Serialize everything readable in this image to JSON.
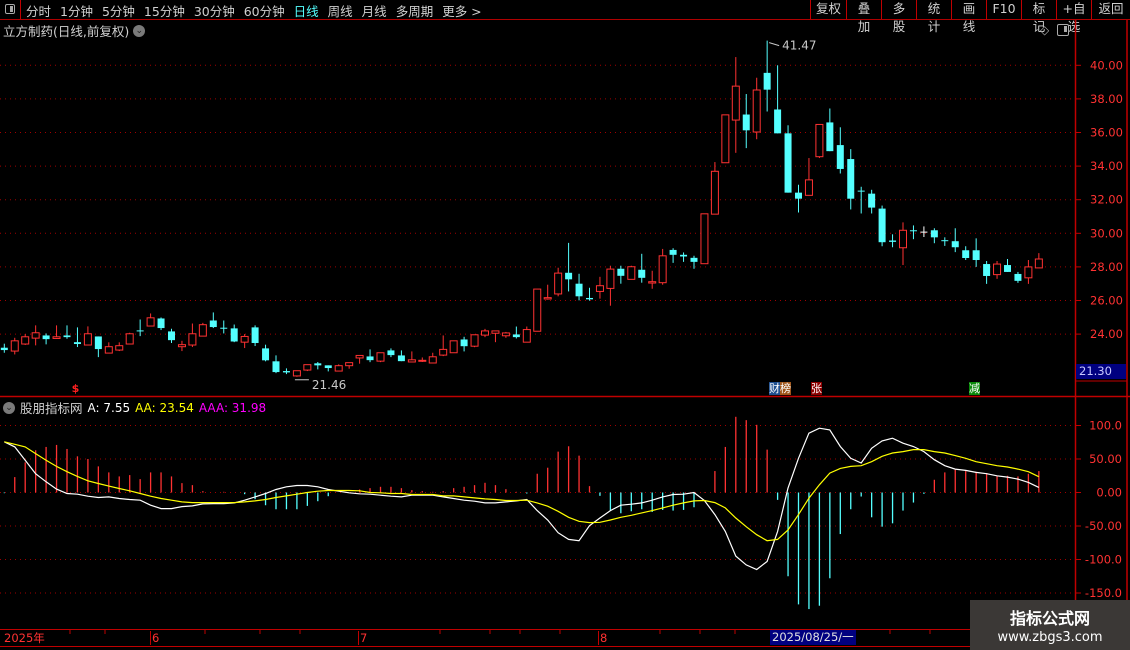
{
  "toolbar": {
    "periods": [
      "分时",
      "1分钟",
      "5分钟",
      "15分钟",
      "30分钟",
      "60分钟",
      "日线",
      "周线",
      "月线",
      "多周期",
      "更多 >"
    ],
    "active_period": "日线",
    "buttons": [
      "复权",
      "叠加",
      "多股",
      "统计",
      "画线",
      "F10",
      "标记",
      "+自选",
      "返回"
    ]
  },
  "main_chart": {
    "title": "立方制药(日线,前复权)",
    "max_label": "41.47",
    "min_label": "21.46",
    "cursor_price": "21.30",
    "price_ticks": [
      "40.00",
      "38.00",
      "36.00",
      "34.00",
      "32.00",
      "30.00",
      "28.00",
      "26.00",
      "24.00"
    ],
    "markers": [
      {
        "text": "$",
        "bg": "",
        "color": "#ff2020"
      },
      {
        "text": "财",
        "bg": "#1f4f8f",
        "color": "#ffffff"
      },
      {
        "text": "榜",
        "bg": "#a0561a",
        "color": "#ffffff"
      },
      {
        "text": "张",
        "bg": "#8b0000",
        "color": "#ffffff"
      },
      {
        "text": "减",
        "bg": "#0a8a0a",
        "color": "#ffffff"
      }
    ]
  },
  "indicator": {
    "name": "股朋指标网",
    "a_label": "A: 7.55",
    "aa_label": "AA: 23.54",
    "aaa_label": "AAA: 31.98",
    "ticks": [
      "100.0",
      "50.00",
      "0.00",
      "-50.00",
      "-100.0",
      "-150.0"
    ]
  },
  "time_axis": {
    "labels": [
      "2025年",
      "6",
      "7",
      "8"
    ],
    "cursor_date": "2025/08/25/一"
  },
  "watermark": {
    "line1": "指标公式网",
    "line2": "www.zbgs3.com"
  },
  "colors": {
    "up": "#ff3232",
    "down": "#54ffff",
    "grid": "#b00000",
    "A": "#ffffff",
    "AA": "#ffff00",
    "AAA": "#ff00ff",
    "accent": "#54ffff"
  },
  "chart_data": [
    {
      "type": "candlestick",
      "ylim": [
        21,
        41.5
      ],
      "ohlc": [
        [
          23.19,
          23.43,
          22.89,
          23.05
        ],
        [
          22.99,
          23.78,
          22.79,
          23.6
        ],
        [
          23.41,
          24.0,
          23.35,
          23.84
        ],
        [
          23.76,
          24.52,
          23.33,
          24.08
        ],
        [
          23.92,
          24.04,
          23.39,
          23.7
        ],
        [
          23.74,
          24.52,
          23.72,
          23.84
        ],
        [
          23.92,
          24.52,
          23.72,
          23.82
        ],
        [
          23.52,
          24.4,
          23.23,
          23.41
        ],
        [
          23.35,
          24.46,
          23.35,
          24.02
        ],
        [
          23.86,
          23.86,
          22.63,
          23.11
        ],
        [
          22.87,
          23.51,
          22.87,
          23.25
        ],
        [
          23.05,
          23.51,
          22.99,
          23.31
        ],
        [
          23.41,
          24.08,
          23.41,
          24.02
        ],
        [
          24.22,
          24.87,
          23.88,
          24.16
        ],
        [
          24.48,
          25.23,
          24.48,
          24.97
        ],
        [
          24.93,
          24.99,
          24.24,
          24.36
        ],
        [
          24.16,
          24.32,
          23.47,
          23.64
        ],
        [
          23.25,
          23.6,
          22.99,
          23.37
        ],
        [
          23.35,
          24.63,
          23.23,
          24.02
        ],
        [
          23.88,
          24.67,
          23.88,
          24.56
        ],
        [
          24.81,
          25.29,
          24.36,
          24.42
        ],
        [
          24.38,
          24.81,
          24.04,
          24.32
        ],
        [
          24.34,
          24.57,
          23.52,
          23.56
        ],
        [
          23.52,
          24.0,
          23.17,
          23.86
        ],
        [
          24.4,
          24.52,
          23.29,
          23.47
        ],
        [
          23.15,
          23.37,
          22.38,
          22.44
        ],
        [
          22.38,
          22.73,
          21.68,
          21.74
        ],
        [
          21.8,
          21.96,
          21.62,
          21.72
        ],
        [
          21.51,
          21.82,
          21.46,
          21.82
        ],
        [
          21.86,
          22.18,
          21.8,
          22.18
        ],
        [
          22.26,
          22.34,
          21.9,
          22.14
        ],
        [
          22.14,
          22.14,
          21.78,
          21.98
        ],
        [
          21.8,
          22.2,
          21.8,
          22.12
        ],
        [
          22.12,
          22.3,
          21.94,
          22.3
        ],
        [
          22.58,
          22.73,
          22.24,
          22.73
        ],
        [
          22.67,
          23.09,
          22.33,
          22.45
        ],
        [
          22.39,
          22.89,
          22.33,
          22.89
        ],
        [
          23.03,
          23.15,
          22.63,
          22.75
        ],
        [
          22.73,
          23.03,
          22.39,
          22.39
        ],
        [
          22.34,
          22.97,
          22.34,
          22.47
        ],
        [
          22.4,
          22.61,
          22.34,
          22.44
        ],
        [
          22.28,
          22.89,
          22.28,
          22.65
        ],
        [
          22.75,
          23.92,
          22.69,
          23.09
        ],
        [
          22.89,
          23.6,
          22.89,
          23.6
        ],
        [
          23.68,
          23.84,
          22.97,
          23.28
        ],
        [
          23.28,
          23.96,
          23.22,
          23.96
        ],
        [
          23.94,
          24.31,
          23.82,
          24.19
        ],
        [
          24.05,
          24.19,
          23.52,
          24.19
        ],
        [
          23.9,
          24.13,
          23.78,
          24.07
        ],
        [
          23.98,
          24.45,
          23.74,
          23.82
        ],
        [
          23.52,
          24.45,
          23.52,
          24.27
        ],
        [
          24.17,
          26.68,
          24.17,
          26.68
        ],
        [
          26.09,
          26.94,
          26.05,
          26.17
        ],
        [
          26.39,
          27.95,
          26.25,
          27.63
        ],
        [
          27.65,
          29.43,
          26.54,
          27.26
        ],
        [
          27.0,
          27.59,
          26.01,
          26.25
        ],
        [
          26.15,
          26.76,
          25.99,
          26.07
        ],
        [
          26.54,
          27.41,
          26.11,
          26.88
        ],
        [
          26.72,
          28.07,
          25.69,
          27.87
        ],
        [
          27.89,
          28.07,
          27.0,
          27.47
        ],
        [
          27.26,
          28.07,
          27.26,
          28.01
        ],
        [
          27.83,
          28.78,
          27.06,
          27.35
        ],
        [
          27.04,
          27.77,
          26.7,
          27.12
        ],
        [
          27.06,
          29.07,
          26.94,
          28.66
        ],
        [
          29.01,
          29.11,
          28.24,
          28.72
        ],
        [
          28.72,
          28.86,
          28.3,
          28.62
        ],
        [
          28.54,
          28.66,
          27.89,
          28.3
        ],
        [
          28.19,
          31.16,
          28.19,
          31.16
        ],
        [
          31.14,
          34.24,
          31.14,
          33.69
        ],
        [
          34.2,
          37.05,
          34.2,
          37.05
        ],
        [
          36.74,
          40.49,
          34.79,
          38.76
        ],
        [
          37.07,
          38.29,
          35.07,
          36.13
        ],
        [
          36.03,
          39.26,
          35.6,
          38.53
        ],
        [
          39.55,
          41.47,
          37.25,
          38.55
        ],
        [
          37.37,
          40.0,
          35.95,
          35.95
        ],
        [
          35.95,
          36.43,
          32.42,
          32.42
        ],
        [
          32.42,
          32.89,
          31.24,
          32.06
        ],
        [
          32.26,
          34.48,
          32.26,
          33.18
        ],
        [
          34.56,
          36.48,
          34.48,
          36.48
        ],
        [
          36.6,
          37.43,
          34.89,
          34.89
        ],
        [
          35.25,
          36.31,
          33.56,
          33.83
        ],
        [
          34.42,
          35.01,
          31.42,
          32.06
        ],
        [
          32.54,
          32.77,
          31.18,
          32.5
        ],
        [
          32.36,
          32.59,
          31.18,
          31.53
        ],
        [
          31.47,
          31.65,
          29.23,
          29.47
        ],
        [
          29.57,
          29.94,
          29.17,
          29.49
        ],
        [
          29.14,
          30.65,
          28.11,
          30.18
        ],
        [
          30.18,
          30.47,
          29.65,
          30.14
        ],
        [
          30.1,
          30.41,
          29.78,
          30.1
        ],
        [
          30.18,
          30.3,
          29.41,
          29.76
        ],
        [
          29.59,
          29.76,
          29.25,
          29.55
        ],
        [
          29.53,
          30.3,
          28.88,
          29.17
        ],
        [
          28.99,
          29.23,
          28.41,
          28.53
        ],
        [
          28.99,
          29.7,
          28.0,
          28.41
        ],
        [
          28.17,
          28.35,
          26.99,
          27.46
        ],
        [
          27.54,
          28.35,
          27.29,
          28.17
        ],
        [
          28.11,
          28.47,
          27.7,
          27.7
        ],
        [
          27.58,
          27.7,
          27.05,
          27.17
        ],
        [
          27.35,
          28.41,
          26.99,
          28.0
        ],
        [
          27.94,
          28.82,
          27.94,
          28.47
        ]
      ]
    },
    {
      "type": "line",
      "ylim": [
        -175,
        125
      ],
      "series": [
        {
          "name": "A",
          "values": [
            75.6,
            68,
            48,
            28,
            16,
            5,
            -1.5,
            -2.5,
            -5.5,
            -7.5,
            -6.5,
            -9,
            -10.5,
            -11.5,
            -19,
            -24,
            -24,
            -21,
            -20,
            -17,
            -16.5,
            -16.5,
            -15.5,
            -11.5,
            -6.5,
            -1.5,
            4.5,
            8.5,
            10.5,
            10.5,
            8.5,
            4.5,
            2,
            -0.5,
            -2,
            -2.5,
            -4,
            -5.5,
            -6.5,
            -4,
            -4,
            -4,
            -6.5,
            -9,
            -11.5,
            -13,
            -15.5,
            -15.5,
            -14,
            -12.5,
            -10.5,
            -27,
            -41,
            -60,
            -70,
            -72,
            -49.5,
            -38,
            -27,
            -19,
            -17.5,
            -15.5,
            -11.5,
            -6.5,
            -3,
            -2.5,
            0,
            -12,
            -33,
            -58,
            -95,
            -108,
            -115,
            -103,
            -58,
            6.5,
            51,
            88.5,
            96,
            93.5,
            68.7,
            51,
            44,
            66,
            77,
            81,
            73.6,
            68.7,
            61,
            49,
            40,
            35,
            33,
            30,
            28,
            25,
            23,
            20,
            15,
            7.55
          ]
        },
        {
          "name": "AA",
          "values": [
            75.6,
            72,
            68,
            58,
            48,
            39,
            31,
            24,
            17.5,
            13.5,
            9.5,
            6,
            2.5,
            -1.5,
            -5.5,
            -9,
            -11.5,
            -14,
            -15,
            -15,
            -15,
            -15,
            -15,
            -14,
            -12.5,
            -10.5,
            -7.5,
            -5,
            -2.5,
            0,
            2,
            3,
            3,
            3,
            2.5,
            0,
            -0.5,
            -1.5,
            -1.5,
            -3,
            -3,
            -3,
            -5,
            -5,
            -6.5,
            -8,
            -9.5,
            -10.5,
            -12,
            -12,
            -11.5,
            -15.5,
            -20.5,
            -28,
            -37,
            -43,
            -45,
            -44.5,
            -41,
            -37,
            -34,
            -30.5,
            -27,
            -23,
            -19,
            -15.5,
            -12.5,
            -12,
            -15,
            -23,
            -38,
            -51,
            -63,
            -72,
            -70,
            -56,
            -33,
            -8.5,
            11.5,
            29,
            36,
            39,
            40,
            46,
            54,
            59,
            61,
            64,
            64,
            61,
            59,
            55,
            51,
            46,
            43,
            40,
            38,
            35,
            31,
            23.54
          ]
        },
        {
          "name": "AAA",
          "type": "bar",
          "values": [
            -1,
            23,
            45,
            63,
            68,
            71,
            65,
            54,
            50,
            39,
            30,
            24,
            26,
            20,
            30,
            30,
            24,
            14,
            11,
            2,
            0,
            1,
            0,
            -2.5,
            -10,
            -19,
            -25,
            -25,
            -25,
            -20,
            -13,
            -5.5,
            0,
            0,
            4.5,
            6.5,
            8.5,
            8.5,
            6.5,
            3.5,
            2,
            1,
            2,
            6.5,
            8.5,
            11,
            14.5,
            11,
            5,
            1,
            -1.5,
            28,
            37,
            61,
            69,
            55,
            9.5,
            -5,
            -27,
            -31,
            -28,
            -25,
            -29,
            -26,
            -27,
            -26,
            -22,
            0.5,
            32,
            68,
            113,
            108,
            101,
            64,
            -11,
            -125,
            -167,
            -174,
            -169,
            -128,
            -62,
            -25,
            -6,
            -37,
            -51,
            -46,
            -27,
            -15,
            -2,
            19,
            30,
            34,
            32,
            31,
            29,
            25,
            25,
            24,
            28,
            31.98
          ]
        }
      ]
    }
  ]
}
